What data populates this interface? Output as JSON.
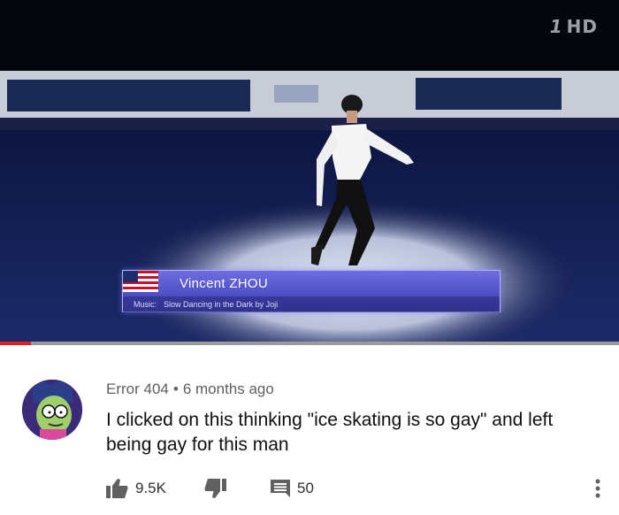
{
  "video": {
    "channel_logo": "HD",
    "skater_name": "Vincent ZHOU",
    "music_label": "Music:",
    "music_title": "Slow Dancing in the Dark by Joji",
    "progress_fraction": 0.05,
    "progress_color": "#e02020"
  },
  "comment": {
    "author": "Error 404",
    "separator": "•",
    "time": "6 months ago",
    "text": "I clicked on this thinking \"ice skating is so gay\" and left being gay for this man",
    "likes": "9.5K",
    "replies": "50",
    "avatar_icon": "avatar-cartoon-character"
  },
  "icons": {
    "like": "thumb-up-icon",
    "dislike": "thumb-down-icon",
    "reply": "comment-icon",
    "more": "vertical-ellipsis-icon"
  }
}
